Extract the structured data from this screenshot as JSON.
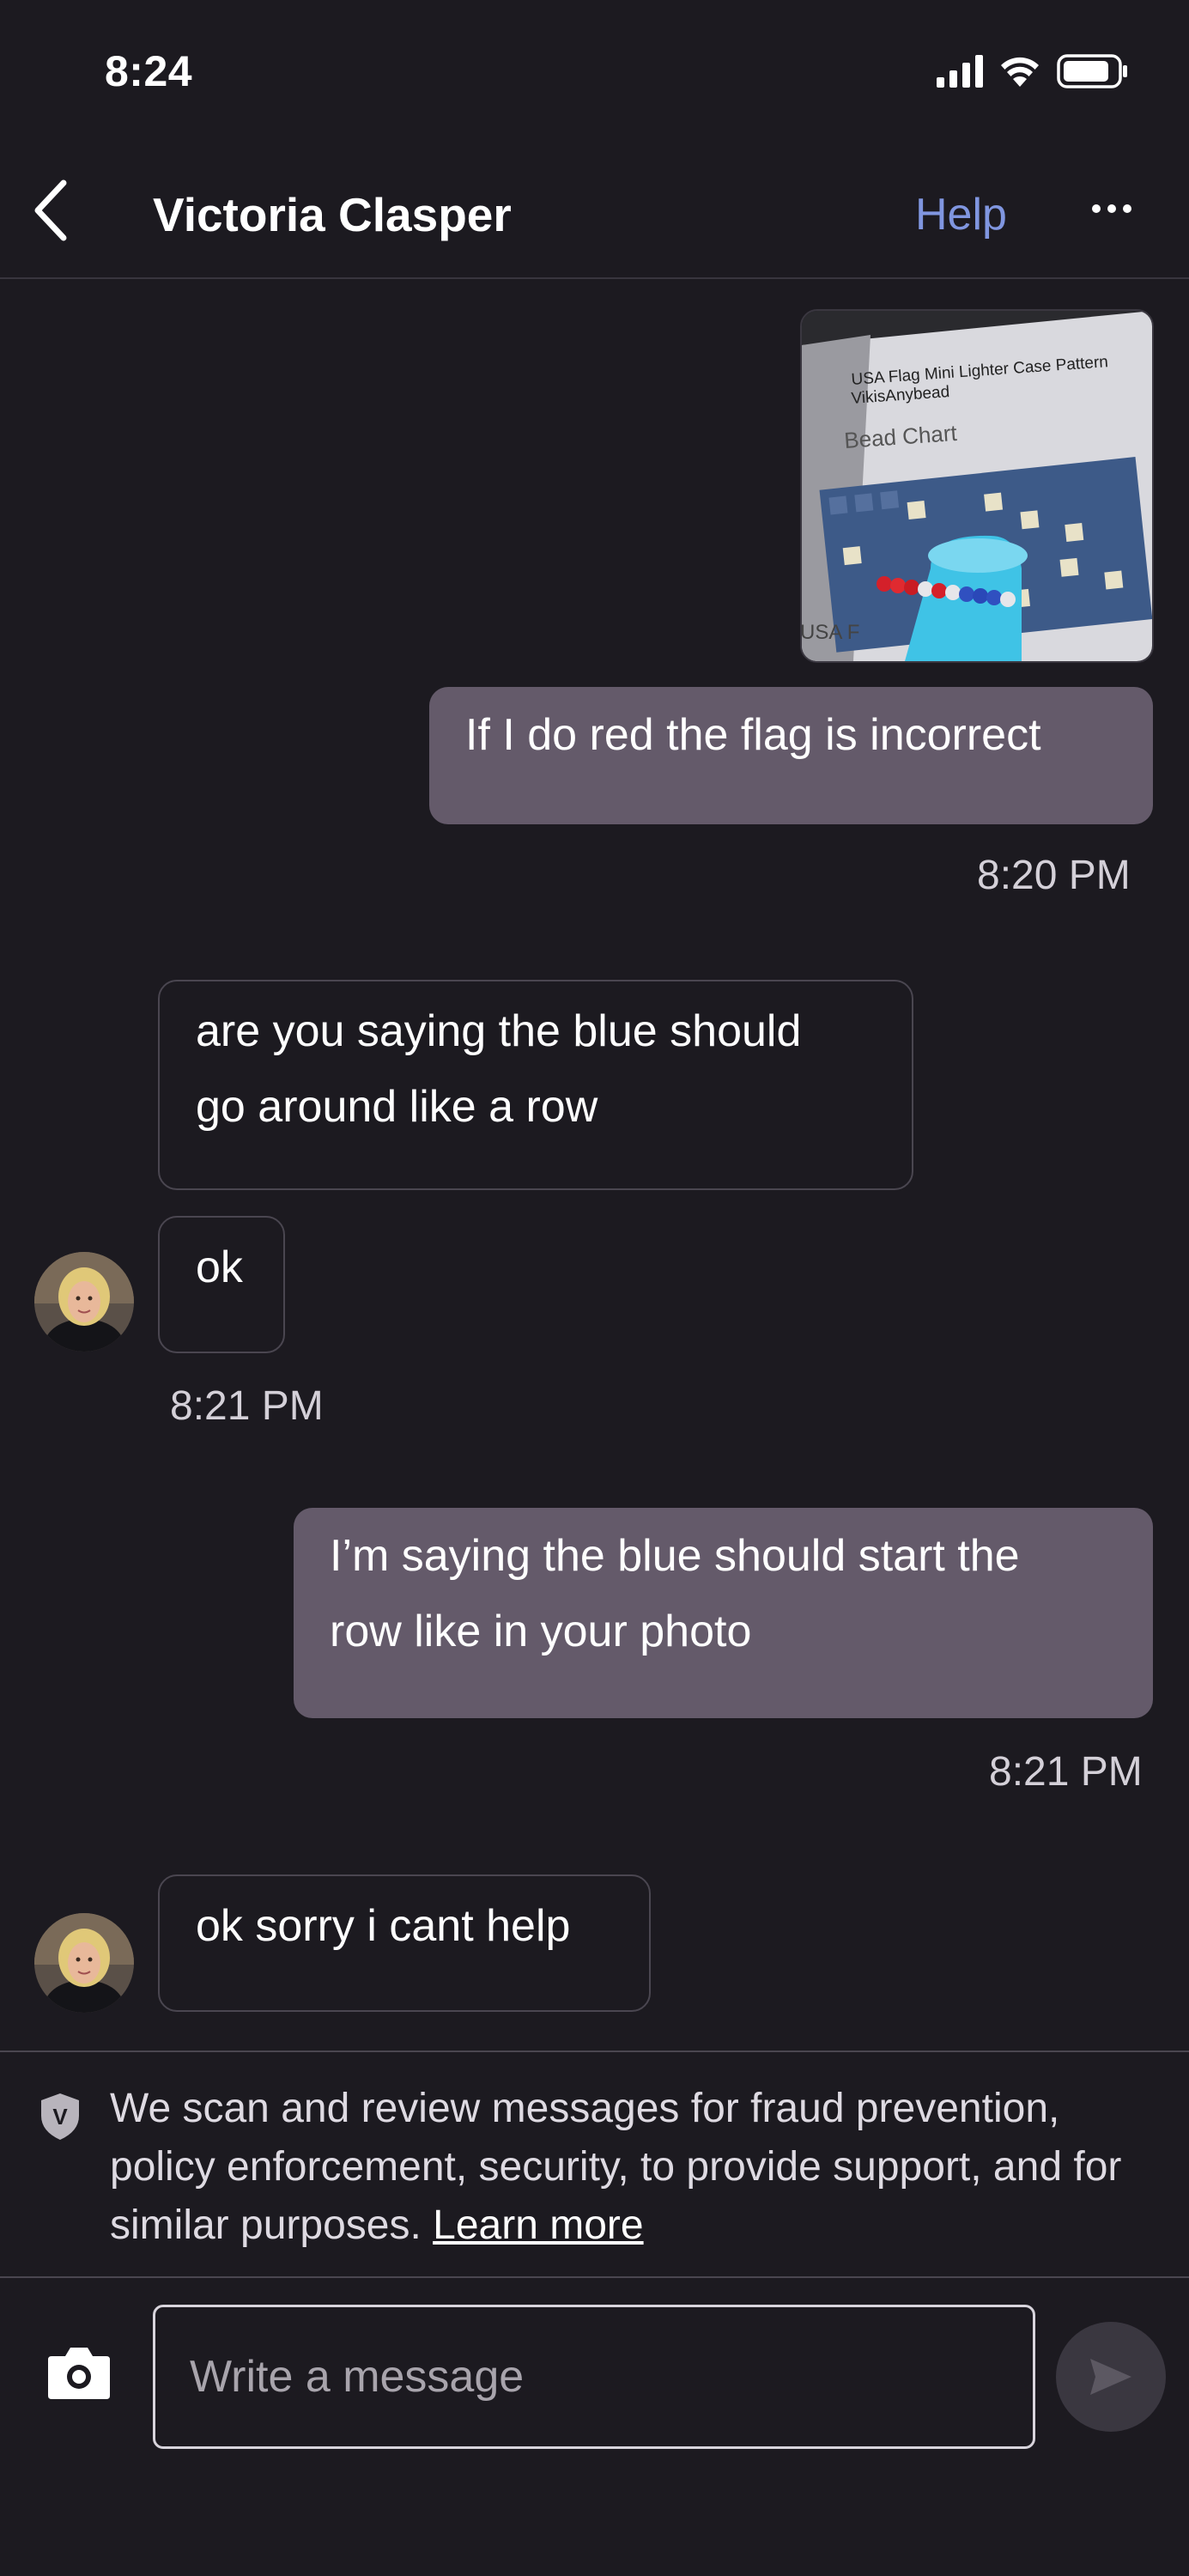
{
  "status_bar": {
    "time": "8:24"
  },
  "header": {
    "contact_name": "Victoria Clasper",
    "help_label": "Help"
  },
  "messages": [
    {
      "type": "image",
      "direction": "out",
      "image_text": {
        "title": "USA Flag Mini Lighter Case Pattern",
        "author": "VikisAnybead",
        "subtitle": "Bead Chart"
      }
    },
    {
      "type": "text",
      "direction": "out",
      "text": "If I do red the flag is incorrect",
      "time": "8:20 PM"
    },
    {
      "type": "text",
      "direction": "in",
      "text_lines": [
        "are you saying the blue should",
        "go around like a row"
      ]
    },
    {
      "type": "text",
      "direction": "in",
      "text": "ok",
      "time": "8:21 PM"
    },
    {
      "type": "text",
      "direction": "out",
      "text_lines": [
        "I’m saying the blue should start the",
        "row like in your photo"
      ],
      "time": "8:21 PM"
    },
    {
      "type": "text",
      "direction": "in",
      "text": "ok sorry i cant help"
    }
  ],
  "notice": {
    "text": "We scan and review messages for fraud prevention, policy enforcement, security, to provide support, and for similar purposes.",
    "link": "Learn more"
  },
  "composer": {
    "placeholder": "Write a message"
  },
  "colors": {
    "background": "#1c1a20",
    "outgoing_bubble": "#645a6a",
    "accent_link": "#8096e0"
  },
  "icons": [
    "back-chevron-icon",
    "more-dots-icon",
    "shield-icon",
    "camera-icon",
    "send-icon",
    "signal-icon",
    "wifi-icon",
    "battery-icon"
  ]
}
